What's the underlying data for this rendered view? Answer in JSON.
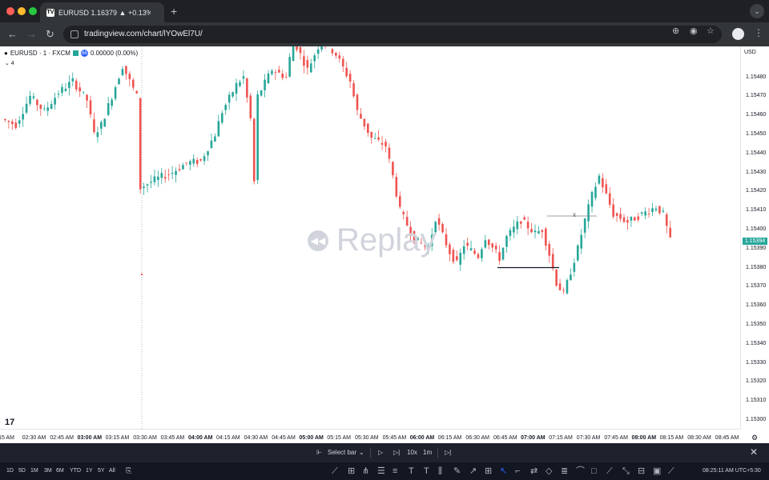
{
  "browser": {
    "tab_title": "EURUSD 1.16379 ▲ +0.13% ",
    "tab_logo": "TV",
    "new_tab_icon": "+",
    "tab_menu_icon": "⌄",
    "url": "tradingview.com/chart/lYOwEl7U/",
    "icons": [
      "back-icon",
      "forward-icon",
      "reload-icon",
      "site-info-icon",
      "zoom-icon",
      "eye-icon",
      "bookmark-star-icon",
      "avatar",
      "menu-icon"
    ]
  },
  "legend": {
    "symbol": "EURUSD · 1 · FXCM",
    "badge": "66",
    "change": "0.00000 (0.00%)",
    "collapse": "⌄ 4"
  },
  "currency": "USD",
  "tv_logo": "17",
  "watermark": "Replay",
  "price_ticks": [
    "1.15480",
    "1.15470",
    "1.15460",
    "1.15450",
    "1.15440",
    "1.15430",
    "1.15420",
    "1.15410",
    "1.15400",
    "1.15390",
    "1.15380",
    "1.15370",
    "1.15360",
    "1.15350",
    "1.15340",
    "1.15330",
    "1.15320",
    "1.15310",
    "1.15300"
  ],
  "last_price": "1.15394",
  "time_ticks": [
    {
      "label": "15 AM",
      "bold": false
    },
    {
      "label": "02:30 AM",
      "bold": false
    },
    {
      "label": "02:45 AM",
      "bold": false
    },
    {
      "label": "03:00 AM",
      "bold": true
    },
    {
      "label": "03:15 AM",
      "bold": false
    },
    {
      "label": "03:30 AM",
      "bold": false
    },
    {
      "label": "03:45 AM",
      "bold": false
    },
    {
      "label": "04:00 AM",
      "bold": true
    },
    {
      "label": "04:15 AM",
      "bold": false
    },
    {
      "label": "04:30 AM",
      "bold": false
    },
    {
      "label": "04:45 AM",
      "bold": false
    },
    {
      "label": "05:00 AM",
      "bold": true
    },
    {
      "label": "05:15 AM",
      "bold": false
    },
    {
      "label": "05:30 AM",
      "bold": false
    },
    {
      "label": "05:45 AM",
      "bold": false
    },
    {
      "label": "06:00 AM",
      "bold": true
    },
    {
      "label": "06:15 AM",
      "bold": false
    },
    {
      "label": "06:30 AM",
      "bold": false
    },
    {
      "label": "06:45 AM",
      "bold": false
    },
    {
      "label": "07:00 AM",
      "bold": true
    },
    {
      "label": "07:15 AM",
      "bold": false
    },
    {
      "label": "07:30 AM",
      "bold": false
    },
    {
      "label": "07:45 AM",
      "bold": false
    },
    {
      "label": "08:00 AM",
      "bold": true
    },
    {
      "label": "08:15 AM",
      "bold": false
    },
    {
      "label": "08:30 AM",
      "bold": false
    },
    {
      "label": "08:45 AM",
      "bold": false
    }
  ],
  "annotation_x": "x",
  "chart_data": {
    "type": "candlestick",
    "symbol": "EURUSD",
    "interval": "1",
    "ylim": [
      1.15295,
      1.1549
    ],
    "colors": {
      "up": "#26a69a",
      "down": "#ef5350"
    },
    "path_keypoints": [
      [
        0,
        1.15458
      ],
      [
        4,
        1.15455
      ],
      [
        8,
        1.1547
      ],
      [
        12,
        1.15462
      ],
      [
        16,
        1.15472
      ],
      [
        20,
        1.15478
      ],
      [
        24,
        1.15468
      ],
      [
        26,
        1.1545
      ],
      [
        28,
        1.15455
      ],
      [
        31,
        1.1547
      ],
      [
        34,
        1.15486
      ],
      [
        38,
        1.1547
      ],
      [
        39,
        1.15422
      ],
      [
        44,
        1.15427
      ],
      [
        48,
        1.1543
      ],
      [
        52,
        1.15435
      ],
      [
        56,
        1.15436
      ],
      [
        60,
        1.1545
      ],
      [
        62,
        1.15462
      ],
      [
        66,
        1.15476
      ],
      [
        68,
        1.1548
      ],
      [
        70,
        1.15458
      ],
      [
        71,
        1.15425
      ],
      [
        72,
        1.1547
      ],
      [
        76,
        1.15484
      ],
      [
        80,
        1.1548
      ],
      [
        82,
        1.155
      ],
      [
        86,
        1.15484
      ],
      [
        90,
        1.155
      ],
      [
        94,
        1.15492
      ],
      [
        98,
        1.15478
      ],
      [
        100,
        1.15462
      ],
      [
        104,
        1.15448
      ],
      [
        108,
        1.15444
      ],
      [
        110,
        1.15428
      ],
      [
        112,
        1.1541
      ],
      [
        116,
        1.15395
      ],
      [
        120,
        1.1539
      ],
      [
        122,
        1.15406
      ],
      [
        126,
        1.15388
      ],
      [
        128,
        1.15382
      ],
      [
        130,
        1.15392
      ],
      [
        134,
        1.15386
      ],
      [
        136,
        1.15396
      ],
      [
        140,
        1.15385
      ],
      [
        142,
        1.15396
      ],
      [
        146,
        1.15405
      ],
      [
        150,
        1.15398
      ],
      [
        152,
        1.154
      ],
      [
        154,
        1.15387
      ],
      [
        156,
        1.15372
      ],
      [
        158,
        1.15366
      ],
      [
        160,
        1.15378
      ],
      [
        162,
        1.1539
      ],
      [
        164,
        1.15405
      ],
      [
        166,
        1.15418
      ],
      [
        168,
        1.15428
      ],
      [
        170,
        1.15418
      ],
      [
        172,
        1.15408
      ],
      [
        176,
        1.15404
      ],
      [
        180,
        1.15408
      ],
      [
        184,
        1.15412
      ],
      [
        186,
        1.15408
      ],
      [
        188,
        1.15394
      ]
    ],
    "annotations": [
      {
        "type": "horizontal-line",
        "price": 1.1538,
        "from_time": "06:57 AM",
        "to_time": "07:13 AM"
      },
      {
        "type": "horizontal-line",
        "price": 1.15407,
        "from_time": "07:15 AM",
        "to_time": "07:30 AM",
        "label": "x"
      },
      {
        "type": "vertical-dotted-line",
        "time": "03:30 AM"
      }
    ]
  },
  "replay": {
    "select_bar": "Select bar",
    "speed": "10x",
    "interval": "1m",
    "icons": [
      "replay-select-icon",
      "play-icon",
      "step-forward-icon",
      "jump-to-realtime-icon",
      "close-replay-icon"
    ]
  },
  "bottom": {
    "ranges": [
      "1D",
      "5D",
      "1M",
      "3M",
      "6M",
      "YTD",
      "1Y",
      "5Y",
      "All"
    ],
    "clock": "08:25:11 AM UTC+5:30"
  }
}
